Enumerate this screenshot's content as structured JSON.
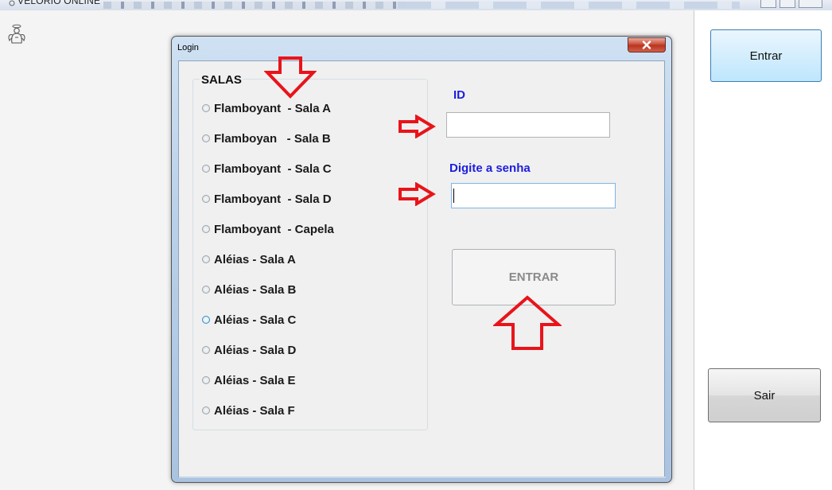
{
  "app": {
    "title": "VELÓRIO ONLINE",
    "icon": "app-icon",
    "mascot_icon": "angel-icon"
  },
  "sidebar": {
    "enter_label": "Entrar",
    "exit_label": "Sair"
  },
  "login_dialog": {
    "title": "Login",
    "close_icon": "close-icon",
    "rooms_group": {
      "title": "SALAS",
      "rooms": [
        {
          "label": "Flamboyant  - Sala A",
          "focused": false
        },
        {
          "label": "Flamboyan   - Sala B",
          "focused": false
        },
        {
          "label": "Flamboyant  - Sala C",
          "focused": false
        },
        {
          "label": "Flamboyant  - Sala D",
          "focused": false
        },
        {
          "label": "Flamboyant  - Capela",
          "focused": false
        },
        {
          "label": "Aléias - Sala A",
          "focused": false
        },
        {
          "label": "Aléias - Sala B",
          "focused": false
        },
        {
          "label": "Aléias - Sala C",
          "focused": true
        },
        {
          "label": "Aléias - Sala D",
          "focused": false
        },
        {
          "label": "Aléias - Sala E",
          "focused": false
        },
        {
          "label": "Aléias - Sala F",
          "focused": false
        }
      ]
    },
    "id_label": "ID",
    "id_value": "",
    "password_label": "Digite a senha",
    "password_value": "",
    "submit_label": "ENTRAR"
  },
  "annotations": {
    "arrow_color": "#e8141a",
    "label_color": "#1d1de0"
  }
}
